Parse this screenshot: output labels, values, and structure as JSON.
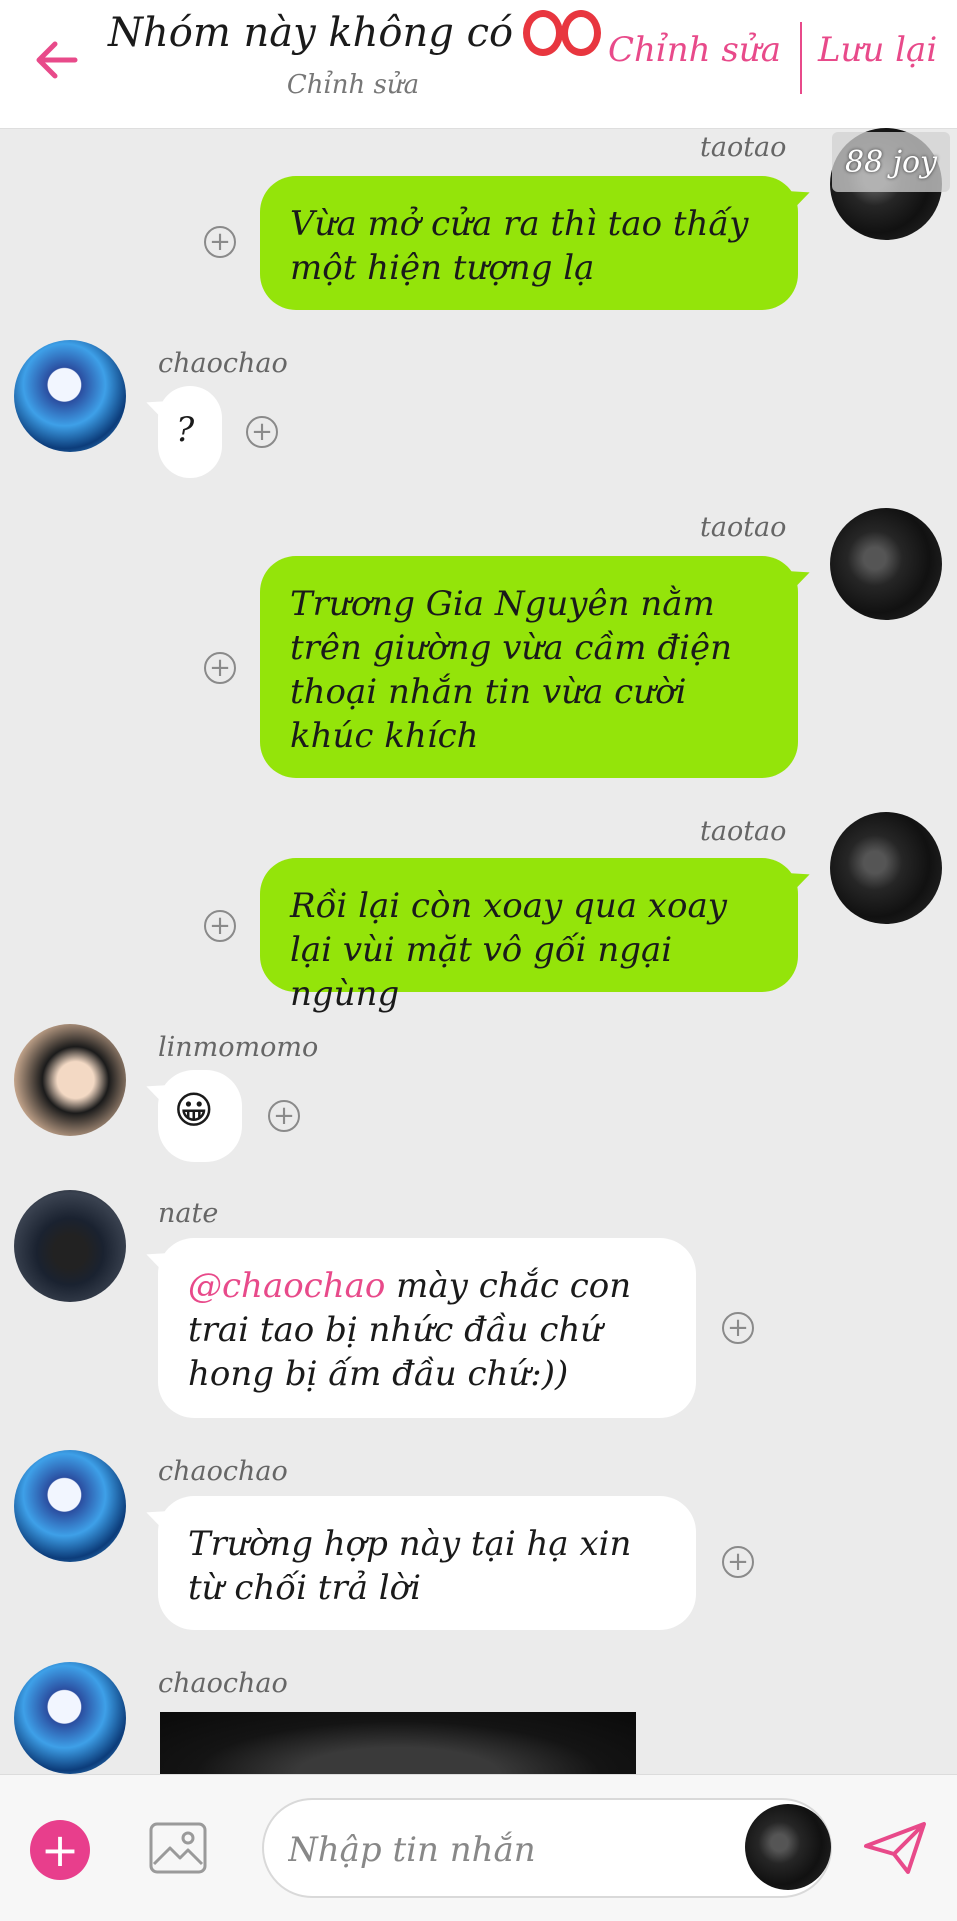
{
  "header": {
    "title": "Nhóm này không có",
    "subtitle": "Chỉnh sửa",
    "edit_label": "Chỉnh sửa",
    "save_label": "Lưu lại",
    "accent_color": "#e84a8a"
  },
  "badge": "88 joy",
  "messages": [
    {
      "sender": "taotao",
      "side": "right",
      "text": "Vừa mở cửa ra thì tao thấy một hiện tượng lạ"
    },
    {
      "sender": "chaochao",
      "side": "left",
      "text": "?"
    },
    {
      "sender": "taotao",
      "side": "right",
      "text": "Trương Gia Nguyên nằm trên giường vừa cầm điện thoại nhắn tin vừa cười khúc khích"
    },
    {
      "sender": "taotao",
      "side": "right",
      "text": "Rồi lại còn xoay qua xoay lại vùi mặt vô gối ngại ngùng"
    },
    {
      "sender": "linmomomo",
      "side": "left",
      "text": "😀"
    },
    {
      "sender": "nate",
      "side": "left",
      "mention": "@chaochao",
      "text": " mày chắc con trai tao bị nhức đầu chứ hong bị ấm đầu chứ:))"
    },
    {
      "sender": "chaochao",
      "side": "left",
      "text": "Trường hợp này tại hạ xin từ chối trả lời"
    },
    {
      "sender": "chaochao",
      "side": "left",
      "text": ""
    }
  ],
  "input": {
    "placeholder": "Nhập tin nhắn"
  },
  "icons": {
    "back": "arrow-left-icon",
    "add": "plus-icon",
    "image": "image-icon",
    "send": "send-icon",
    "plus_small": "plus-circle-icon"
  },
  "colors": {
    "green_bubble": "#94e40a",
    "white_bubble": "#ffffff",
    "background": "#ebebeb",
    "accent": "#e84a8a"
  }
}
